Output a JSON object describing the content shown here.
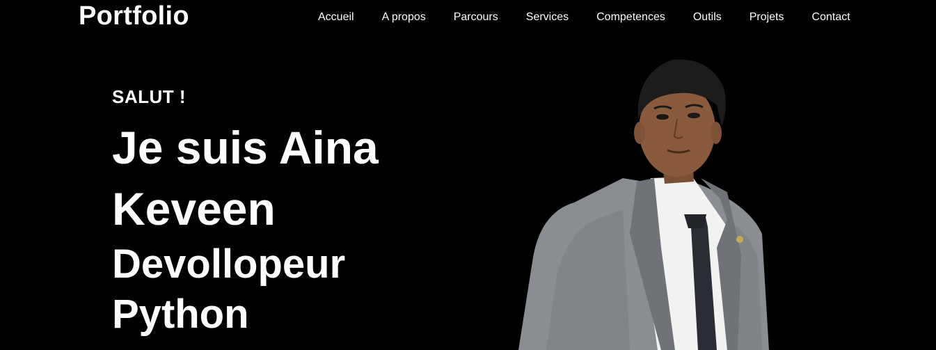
{
  "header": {
    "logo": "Portfolio",
    "nav": [
      {
        "label": "Accueil"
      },
      {
        "label": "A propos"
      },
      {
        "label": "Parcours"
      },
      {
        "label": "Services"
      },
      {
        "label": "Competences"
      },
      {
        "label": "Outils"
      },
      {
        "label": "Projets"
      },
      {
        "label": "Contact"
      }
    ]
  },
  "hero": {
    "greeting": "SALUT !",
    "name_line1": "Je suis Aina",
    "name_line2": "Keveen",
    "role_line1": "Devollopeur",
    "role_line2": "Python"
  },
  "colors": {
    "background": "#000000",
    "text": "#ffffff",
    "suit": "#8a8d92",
    "shirt": "#f2f2f2",
    "tie": "#2a2d33",
    "skin": "#8a5a3c",
    "hair": "#1c1c1c"
  }
}
